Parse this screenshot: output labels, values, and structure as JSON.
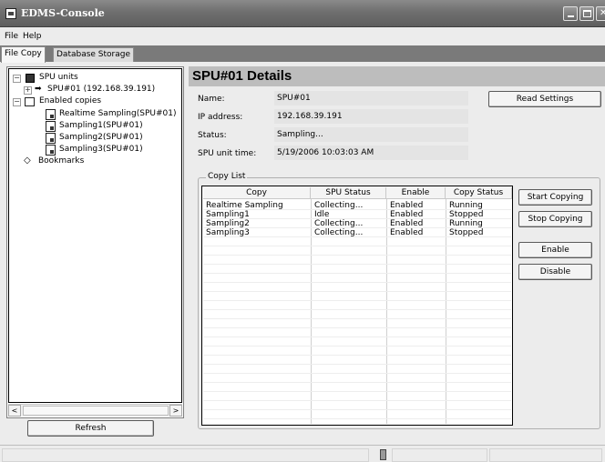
{
  "window": {
    "title": "EDMS-Console"
  },
  "menu": [
    {
      "label": "File"
    },
    {
      "label": "Help"
    }
  ],
  "tabs": [
    {
      "label": "File Copy"
    },
    {
      "label": "Database Storage"
    }
  ],
  "tree": {
    "spu_units": "SPU units",
    "spu01": "SPU#01 (192.168.39.191)",
    "enabled_copies": "Enabled copies",
    "copies": [
      "Realtime Sampling(SPU#01)",
      "Sampling1(SPU#01)",
      "Sampling2(SPU#01)",
      "Sampling3(SPU#01)"
    ],
    "bookmarks": "Bookmarks"
  },
  "left_buttons": {
    "refresh": "Refresh"
  },
  "details": {
    "title": "SPU#01 Details",
    "fields": [
      {
        "label": "Name:",
        "value": "SPU#01"
      },
      {
        "label": "IP address:",
        "value": "192.168.39.191"
      },
      {
        "label": "Status:",
        "value": "Sampling..."
      },
      {
        "label": "SPU unit time:",
        "value": "5/19/2006 10:03:03 AM"
      }
    ],
    "read_settings": "Read Settings"
  },
  "copy_list": {
    "group_label": "Copy List",
    "columns": [
      "Copy",
      "SPU Status",
      "Enable",
      "Copy Status"
    ],
    "rows": [
      [
        "Realtime Sampling",
        "Collecting...",
        "Enabled",
        "Running"
      ],
      [
        "Sampling1",
        "Idle",
        "Enabled",
        "Stopped"
      ],
      [
        "Sampling2",
        "Collecting...",
        "Enabled",
        "Running"
      ],
      [
        "Sampling3",
        "Collecting...",
        "Enabled",
        "Stopped"
      ]
    ],
    "buttons": {
      "start": "Start Copying",
      "stop": "Stop Copying",
      "enable": "Enable",
      "disable": "Disable"
    }
  },
  "icons": {
    "app": "app-icon",
    "minimize": "minimize-icon",
    "maximize": "maximize-icon",
    "close": "close-icon",
    "database": "database-icon",
    "arrow": "arrow-right-icon",
    "copies": "copies-icon",
    "document": "document-icon",
    "bookmark": "bookmark-icon"
  },
  "colors": {
    "titlebar": "#6f6f6f",
    "header_band": "#bdbdbd",
    "field_bg": "#e4e4e4"
  }
}
